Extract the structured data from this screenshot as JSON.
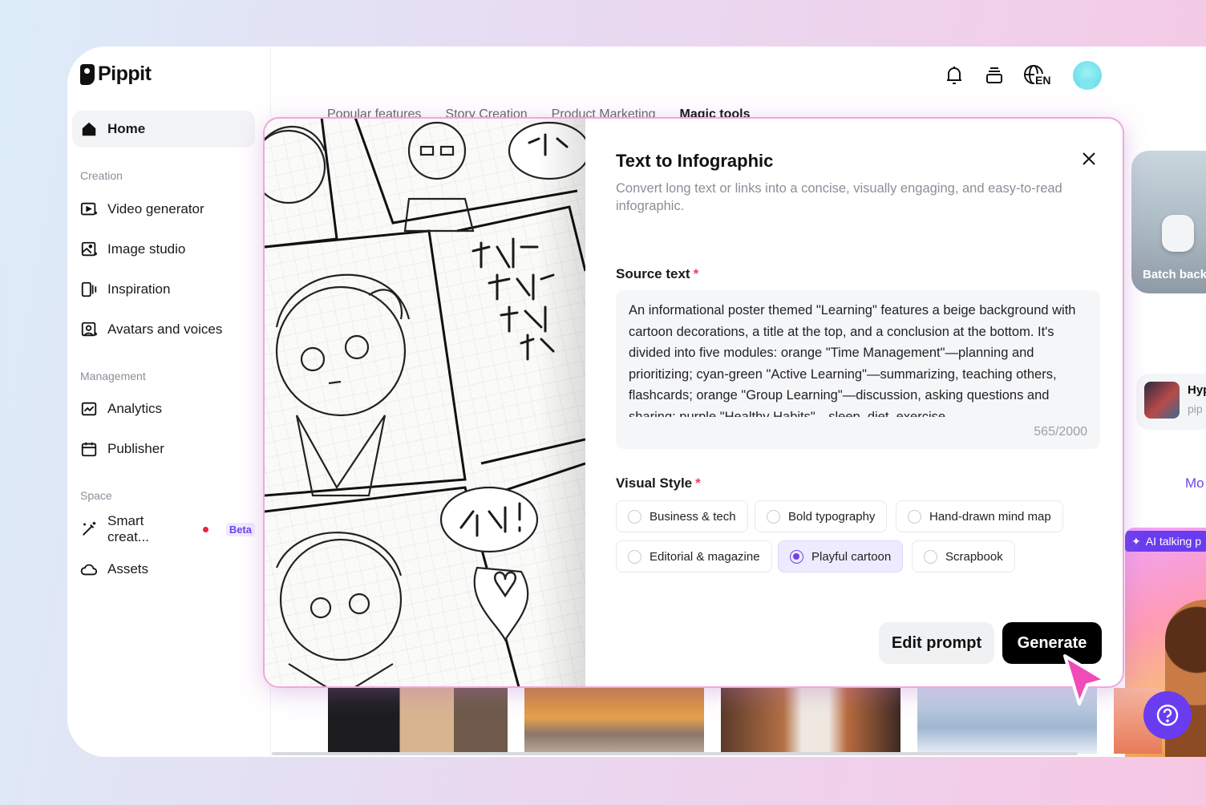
{
  "app": {
    "name": "Pippit"
  },
  "sidebar": {
    "home": "Home",
    "sections": {
      "creation": "Creation",
      "management": "Management",
      "space": "Space"
    },
    "creation_items": [
      "Video generator",
      "Image studio",
      "Inspiration",
      "Avatars and voices"
    ],
    "management_items": [
      "Analytics",
      "Publisher"
    ],
    "space_items": {
      "smart_creation": "Smart creat...",
      "beta": "Beta",
      "assets": "Assets"
    }
  },
  "topbar": {
    "language": "EN"
  },
  "tabs": [
    "Popular features",
    "Story Creation",
    "Product Marketing",
    "Magic tools"
  ],
  "background": {
    "batch_card": "Batch back",
    "mini_card_title": "Hyp",
    "mini_card_sub": "pip",
    "more_link": "Mo",
    "ai_talking": "AI talking p"
  },
  "modal": {
    "title": "Text to Infographic",
    "description": "Convert long text or links into a concise, visually engaging, and easy-to-read infographic.",
    "source_label": "Source text",
    "required_mark": "*",
    "source_text": "An informational poster themed \"Learning\" features a beige background with cartoon decorations, a title at the top, and a conclusion at the bottom. It's divided into five modules: orange \"Time Management\"—planning and prioritizing; cyan-green \"Active Learning\"—summarizing, teaching others, flashcards; orange \"Group Learning\"—discussion, asking questions and sharing; purple \"Healthy Habits\"—sleep, diet, exercise...",
    "char_count": "565/2000",
    "style_label": "Visual Style",
    "styles": [
      "Business & tech",
      "Bold typography",
      "Hand-drawn mind map",
      "Editorial & magazine",
      "Playful cartoon",
      "Scrapbook"
    ],
    "selected_style": "Playful cartoon",
    "edit_prompt": "Edit prompt",
    "generate": "Generate"
  },
  "colors": {
    "accent": "#6f45e8",
    "modal_border": "#f2a6dc",
    "required": "#ef3f5f",
    "help_button": "#6a3cf0"
  }
}
